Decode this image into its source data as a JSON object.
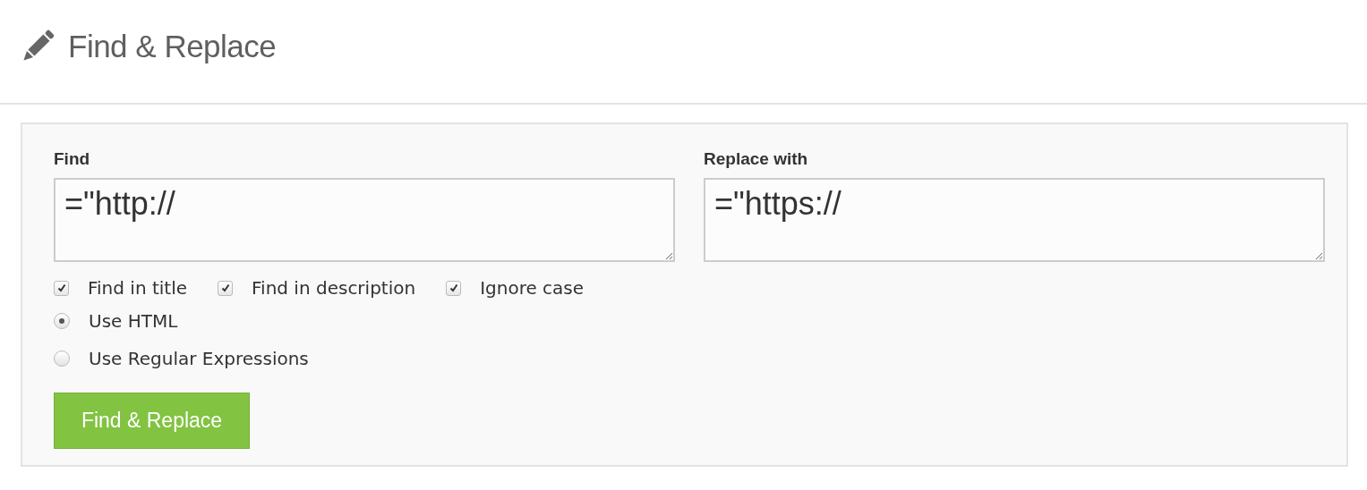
{
  "header": {
    "title": "Find & Replace"
  },
  "fields": [
    {
      "label": "Find",
      "value": "=\"http://"
    },
    {
      "label": "Replace with",
      "value": "=\"https://"
    }
  ],
  "options": [
    {
      "kind": "checkbox",
      "label": "Find in title",
      "checked": true
    },
    {
      "kind": "checkbox",
      "label": "Find in description",
      "checked": true
    },
    {
      "kind": "checkbox",
      "label": "Ignore case",
      "checked": true
    },
    {
      "kind": "radio",
      "label": "Use HTML",
      "selected": true
    },
    {
      "kind": "radio",
      "label": "Use Regular Expressions",
      "selected": false
    }
  ],
  "submit_button": "Find & Replace"
}
